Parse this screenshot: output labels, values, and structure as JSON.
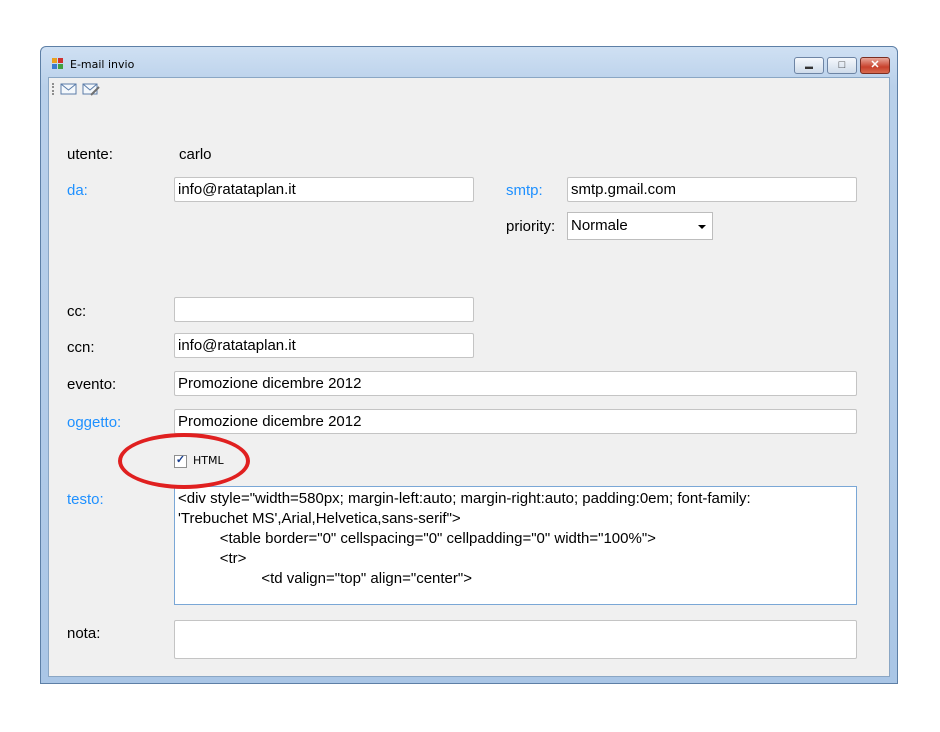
{
  "window": {
    "title": "E-mail invio",
    "minimize_symbol": "▬",
    "maximize_symbol": "□",
    "close_symbol": "✕",
    "toolbar": [
      "mail-send-icon",
      "mail-edit-icon"
    ]
  },
  "form": {
    "utente_label": "utente:",
    "utente_value": "carlo",
    "da_label": "da:",
    "da_value": "info@ratataplan.it",
    "smtp_label": "smtp:",
    "smtp_value": "smtp.gmail.com",
    "priority_label": "priority:",
    "priority_value": "Normale",
    "cc_label": "cc:",
    "cc_value": "",
    "ccn_label": "ccn:",
    "ccn_value": "info@ratataplan.it",
    "evento_label": "evento:",
    "evento_value": "Promozione dicembre 2012",
    "oggetto_label": "oggetto:",
    "oggetto_value": "Promozione dicembre 2012",
    "html_checkbox_label": "HTML",
    "html_checked": true,
    "testo_label": "testo:",
    "testo_lines": [
      "<div style=\"width=580px; margin-left:auto; margin-right:auto; padding:0em; font-family:",
      "'Trebuchet MS',Arial,Helvetica,sans-serif\">",
      "\t\t<table border=\"0\" cellspacing=\"0\" cellpadding=\"0\" width=\"100%\">",
      "\t\t<tr>",
      "\t\t\t\t<td valign=\"top\" align=\"center\">"
    ],
    "nota_label": "nota:",
    "nota_value": ""
  },
  "colors": {
    "label_blue": "#1e90ff",
    "highlight_red": "#e02020",
    "titlebar": "#b9d0ea"
  }
}
